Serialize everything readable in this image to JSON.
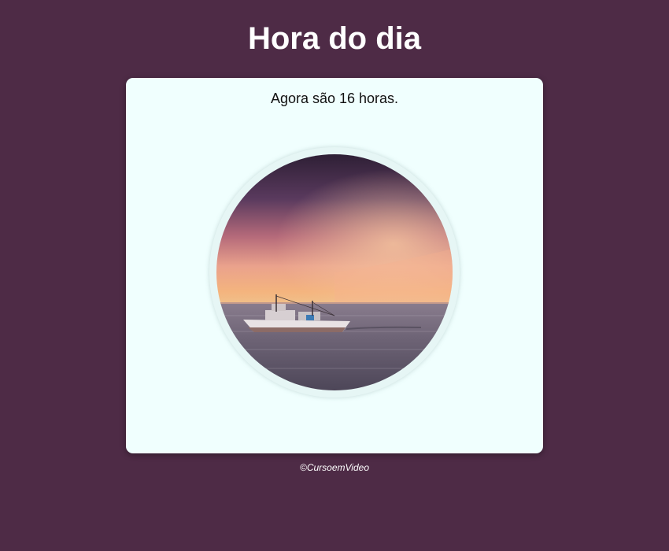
{
  "header": {
    "title": "Hora do dia"
  },
  "card": {
    "message": "Agora são 16 horas.",
    "image": {
      "subject": "boat-at-sunset"
    }
  },
  "footer": {
    "text": "©CursoemVideo"
  },
  "colors": {
    "background": "#4e2b46",
    "card": "#f0fffe",
    "title": "#ffffff"
  }
}
